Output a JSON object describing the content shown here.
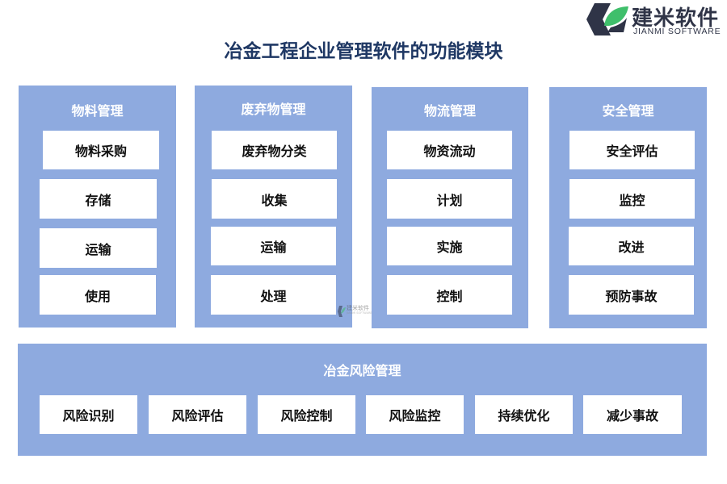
{
  "logo": {
    "name_cn": "建米软件",
    "name_en": "JIANMI SOFTWARE",
    "colors": {
      "dark": "#2f3447",
      "green": "#3fbf6b"
    }
  },
  "title": "冶金工程企业管理软件的功能模块",
  "colors": {
    "panel": "#8eaadf",
    "item": "#ffffff",
    "title": "#1f3864"
  },
  "modules": [
    {
      "title": "物料管理",
      "items": [
        "物料采购",
        "存储",
        "运输",
        "使用"
      ]
    },
    {
      "title": "废弃物管理",
      "items": [
        "废弃物分类",
        "收集",
        "运输",
        "处理"
      ]
    },
    {
      "title": "物流管理",
      "items": [
        "物资流动",
        "计划",
        "实施",
        "控制"
      ]
    },
    {
      "title": "安全管理",
      "items": [
        "安全评估",
        "监控",
        "改进",
        "预防事故"
      ]
    }
  ],
  "risk_module": {
    "title": "冶金风险管理",
    "items": [
      "风险识别",
      "风险评估",
      "风险控制",
      "风险监控",
      "持续优化",
      "减少事故"
    ]
  },
  "watermark": {
    "name_cn": "建米软件",
    "name_en": "JIANMI SOFTWARE"
  }
}
